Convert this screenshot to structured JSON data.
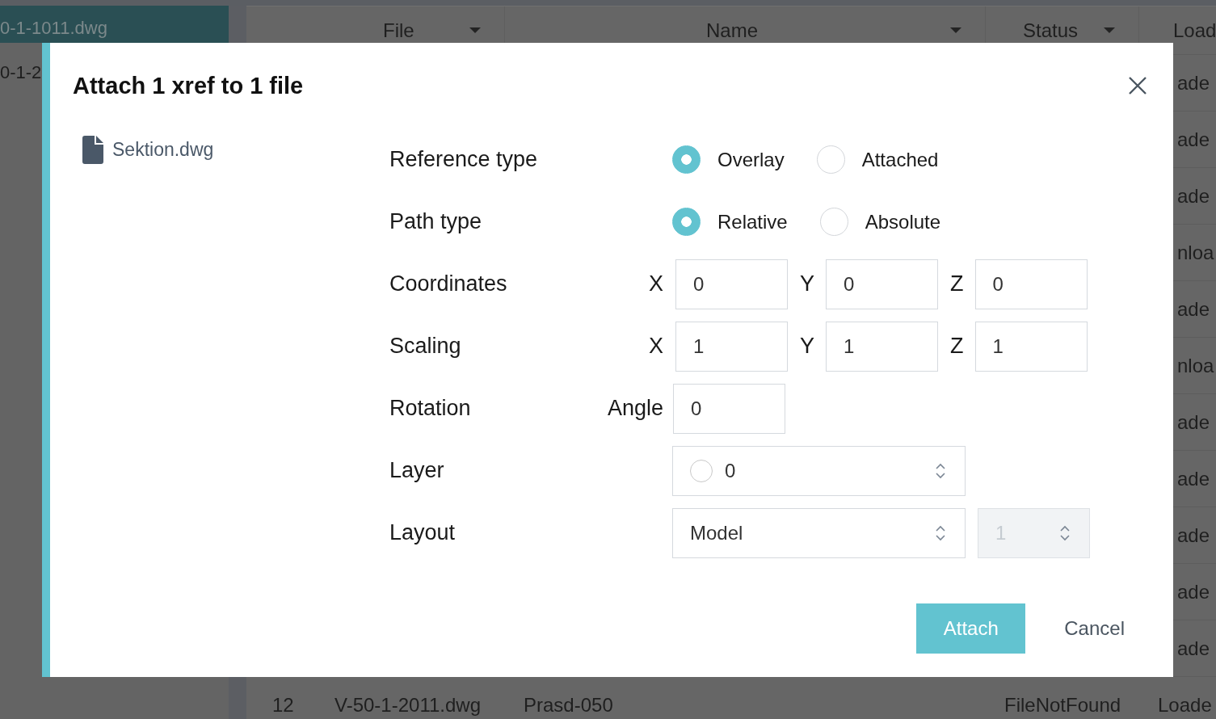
{
  "app": {
    "sidebar": {
      "items": [
        {
          "label": "0-1-1011.dwg",
          "selected": true
        },
        {
          "label": "0-1-2",
          "selected": false
        }
      ]
    },
    "table": {
      "columns": [
        {
          "label": "File",
          "dropdown": true
        },
        {
          "label": "Name",
          "dropdown": true
        },
        {
          "label": "Status",
          "dropdown": true
        },
        {
          "label": "Load"
        }
      ],
      "rows": [
        {
          "kind": "covered",
          "load": "ade"
        },
        {
          "kind": "covered",
          "load": "ade"
        },
        {
          "kind": "covered",
          "load": "ade"
        },
        {
          "kind": "covered",
          "load": "nloa"
        },
        {
          "kind": "covered",
          "load": "ade"
        },
        {
          "kind": "covered",
          "load": "nloa"
        },
        {
          "kind": "covered",
          "load": "ade"
        },
        {
          "kind": "covered",
          "load": "ade"
        },
        {
          "kind": "covered",
          "load": "ade"
        },
        {
          "kind": "covered",
          "load": "ade"
        },
        {
          "kind": "covered",
          "load": "ade"
        },
        {
          "kind": "full",
          "number": "12",
          "file": "V-50-1-2011.dwg",
          "name": "Prasd-050",
          "status": "FileNotFound",
          "load": "Loade"
        }
      ]
    }
  },
  "dialog": {
    "title": "Attach 1 xref to 1 file",
    "files": [
      {
        "name": "Sektion.dwg"
      }
    ],
    "fields": [
      {
        "kind": "radio",
        "label": "Reference type",
        "options": [
          {
            "label": "Overlay",
            "selected": true
          },
          {
            "label": "Attached",
            "selected": false
          }
        ]
      },
      {
        "kind": "radio",
        "label": "Path type",
        "options": [
          {
            "label": "Relative",
            "selected": true
          },
          {
            "label": "Absolute",
            "selected": false
          }
        ]
      },
      {
        "kind": "xyz",
        "label": "Coordinates",
        "inputs": [
          {
            "axis": "X",
            "value": "0"
          },
          {
            "axis": "Y",
            "value": "0"
          },
          {
            "axis": "Z",
            "value": "0"
          }
        ]
      },
      {
        "kind": "xyz",
        "label": "Scaling",
        "inputs": [
          {
            "axis": "X",
            "value": "1"
          },
          {
            "axis": "Y",
            "value": "1"
          },
          {
            "axis": "Z",
            "value": "1"
          }
        ]
      },
      {
        "kind": "angle",
        "label": "Rotation",
        "prefix": "Angle",
        "value": "0"
      },
      {
        "kind": "layer",
        "label": "Layer",
        "value": "0"
      },
      {
        "kind": "layout",
        "label": "Layout",
        "value": "Model",
        "page": {
          "value": "1",
          "disabled": true
        }
      }
    ],
    "buttons": [
      {
        "label": "Attach",
        "kind": "primary"
      },
      {
        "label": "Cancel",
        "kind": "secondary"
      }
    ]
  }
}
